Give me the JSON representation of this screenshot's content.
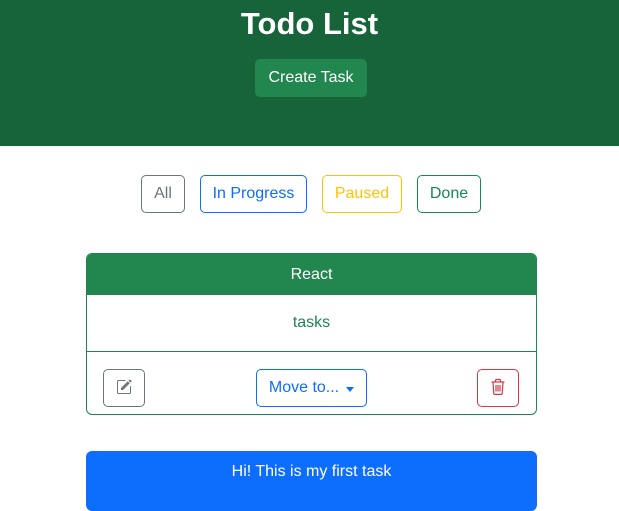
{
  "header": {
    "title": "Todo List",
    "create_button": "Create Task",
    "background": "#18643a"
  },
  "filters": [
    {
      "label": "All",
      "color": "#6c757d"
    },
    {
      "label": "In Progress",
      "color": "#0d6efd"
    },
    {
      "label": "Paused",
      "color": "#ffc107"
    },
    {
      "label": "Done",
      "color": "#198754"
    }
  ],
  "tasks": [
    {
      "title": "React",
      "description": "tasks",
      "status_color": "#198754",
      "edit_icon": "pencil-square-icon",
      "move_label": "Move to...",
      "delete_icon": "trash-icon"
    },
    {
      "title": "Hi! This is my first task",
      "status_color": "#0d6efd"
    }
  ]
}
